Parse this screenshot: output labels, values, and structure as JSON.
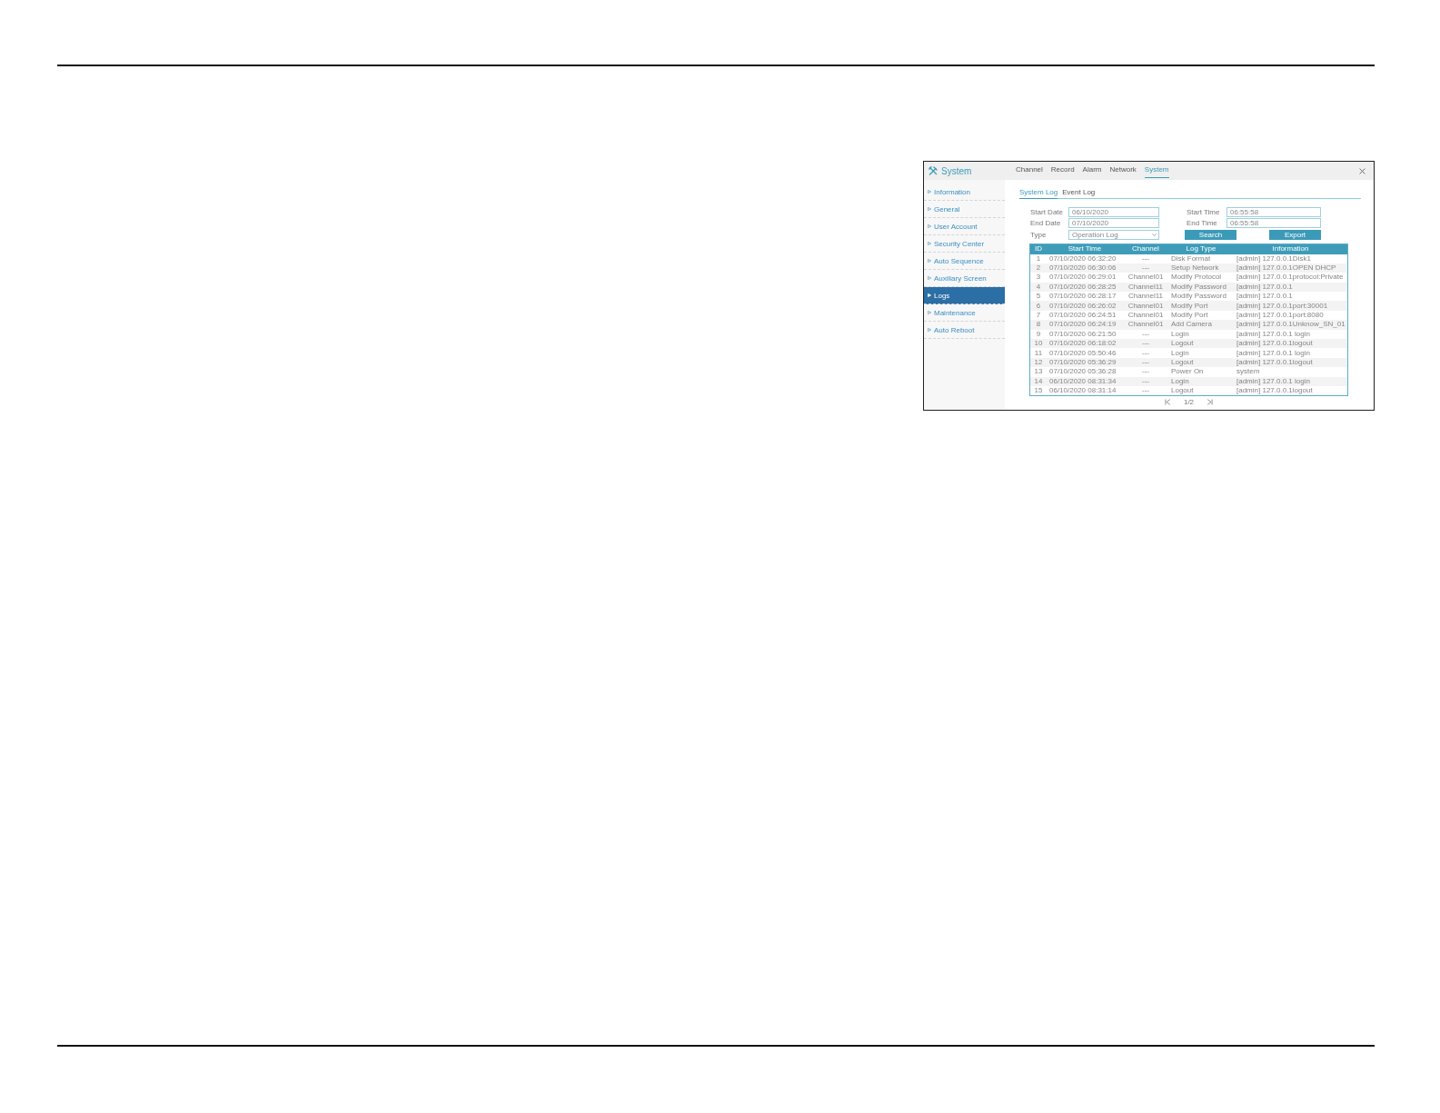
{
  "window": {
    "title": "System"
  },
  "tabs": [
    {
      "label": "Channel",
      "selected": false
    },
    {
      "label": "Record",
      "selected": false
    },
    {
      "label": "Alarm",
      "selected": false
    },
    {
      "label": "Network",
      "selected": false
    },
    {
      "label": "System",
      "selected": true
    }
  ],
  "sidebar": {
    "items": [
      {
        "label": "Information",
        "selected": false
      },
      {
        "label": "General",
        "selected": false
      },
      {
        "label": "User Account",
        "selected": false
      },
      {
        "label": "Security Center",
        "selected": false
      },
      {
        "label": "Auto Sequence",
        "selected": false
      },
      {
        "label": "Auxiliary Screen",
        "selected": false
      },
      {
        "label": "Logs",
        "selected": true
      },
      {
        "label": "Maintenance",
        "selected": false
      },
      {
        "label": "Auto Reboot",
        "selected": false
      }
    ]
  },
  "subtabs": [
    {
      "label": "System Log",
      "selected": true
    },
    {
      "label": "Event Log",
      "selected": false
    }
  ],
  "filters": {
    "start_date": {
      "label": "Start Date",
      "value": "06/10/2020"
    },
    "start_time": {
      "label": "Start Time",
      "value": "06:55:58"
    },
    "end_date": {
      "label": "End Date",
      "value": "07/10/2020"
    },
    "end_time": {
      "label": "End Time",
      "value": "06:55:58"
    },
    "type": {
      "label": "Type",
      "value": "Operation Log"
    }
  },
  "buttons": [
    "Search",
    "Export"
  ],
  "table": {
    "columns": [
      "ID",
      "Start Time",
      "Channel",
      "Log Type",
      "Information"
    ],
    "rows": [
      [
        "1",
        "07/10/2020 06:32:20",
        "---",
        "Disk Format",
        "[admin] 127.0.0.1Disk1"
      ],
      [
        "2",
        "07/10/2020 06:30:06",
        "---",
        "Setup Network",
        "[admin] 127.0.0.1OPEN DHCP"
      ],
      [
        "3",
        "07/10/2020 06:29:01",
        "Channel01",
        "Modify Protocol",
        "[admin] 127.0.0.1protocol:Private"
      ],
      [
        "4",
        "07/10/2020 06:28:25",
        "Channel11",
        "Modify Password",
        "[admin] 127.0.0.1"
      ],
      [
        "5",
        "07/10/2020 06:28:17",
        "Channel11",
        "Modify Password",
        "[admin] 127.0.0.1"
      ],
      [
        "6",
        "07/10/2020 06:26:02",
        "Channel01",
        "Modify Port",
        "[admin] 127.0.0.1port:30001"
      ],
      [
        "7",
        "07/10/2020 06:24:51",
        "Channel01",
        "Modify Port",
        "[admin] 127.0.0.1port:8080"
      ],
      [
        "8",
        "07/10/2020 06:24:19",
        "Channel01",
        "Add Camera",
        "[admin] 127.0.0.1Unknow_SN_01"
      ],
      [
        "9",
        "07/10/2020 06:21:50",
        "---",
        "Login",
        "[admin] 127.0.0.1 login"
      ],
      [
        "10",
        "07/10/2020 06:18:02",
        "---",
        "Logout",
        "[admin] 127.0.0.1logout"
      ],
      [
        "11",
        "07/10/2020 05:50:46",
        "---",
        "Login",
        "[admin] 127.0.0.1 login"
      ],
      [
        "12",
        "07/10/2020 05:36:29",
        "---",
        "Logout",
        "[admin] 127.0.0.1logout"
      ],
      [
        "13",
        "07/10/2020 05:36:28",
        "---",
        "Power On",
        "system"
      ],
      [
        "14",
        "06/10/2020 08:31:34",
        "---",
        "Login",
        "[admin] 127.0.0.1 login"
      ],
      [
        "15",
        "06/10/2020 08:31:14",
        "---",
        "Logout",
        "[admin] 127.0.0.1logout"
      ]
    ]
  },
  "pagination": {
    "page": "1/2"
  }
}
